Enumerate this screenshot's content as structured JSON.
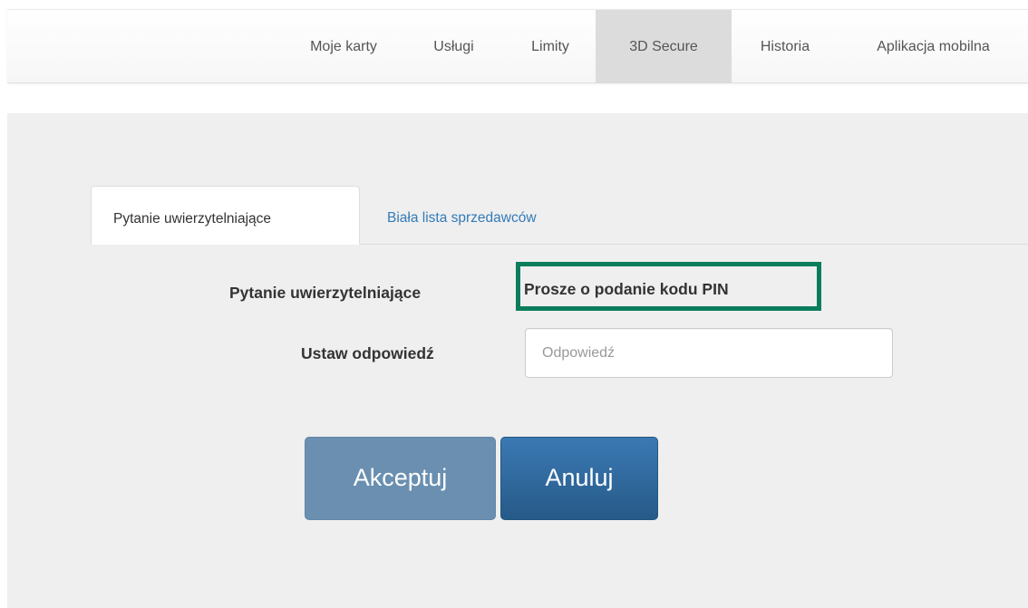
{
  "nav": {
    "items": [
      {
        "label": "Moje karty",
        "active": false
      },
      {
        "label": "Usługi",
        "active": false
      },
      {
        "label": "Limity",
        "active": false
      },
      {
        "label": "3D Secure",
        "active": true
      },
      {
        "label": "Historia",
        "active": false
      },
      {
        "label": "Aplikacja mobilna",
        "active": false
      }
    ]
  },
  "tabs": {
    "items": [
      {
        "label": "Pytanie uwierzytelniające",
        "active": true
      },
      {
        "label": "Biała lista sprzedawców",
        "active": false
      }
    ]
  },
  "form": {
    "question_label": "Pytanie uwierzytelniające",
    "question_value": "Prosze o podanie kodu PIN",
    "answer_label": "Ustaw odpowiedź",
    "answer_value": "",
    "answer_placeholder": "Odpowiedź"
  },
  "buttons": {
    "accept_label": "Akceptuj",
    "cancel_label": "Anuluj"
  },
  "colors": {
    "highlight_border": "#0a7d5c",
    "link": "#337ab7",
    "accept_button": "#6a8fb0",
    "cancel_button": "#2e6da4"
  }
}
